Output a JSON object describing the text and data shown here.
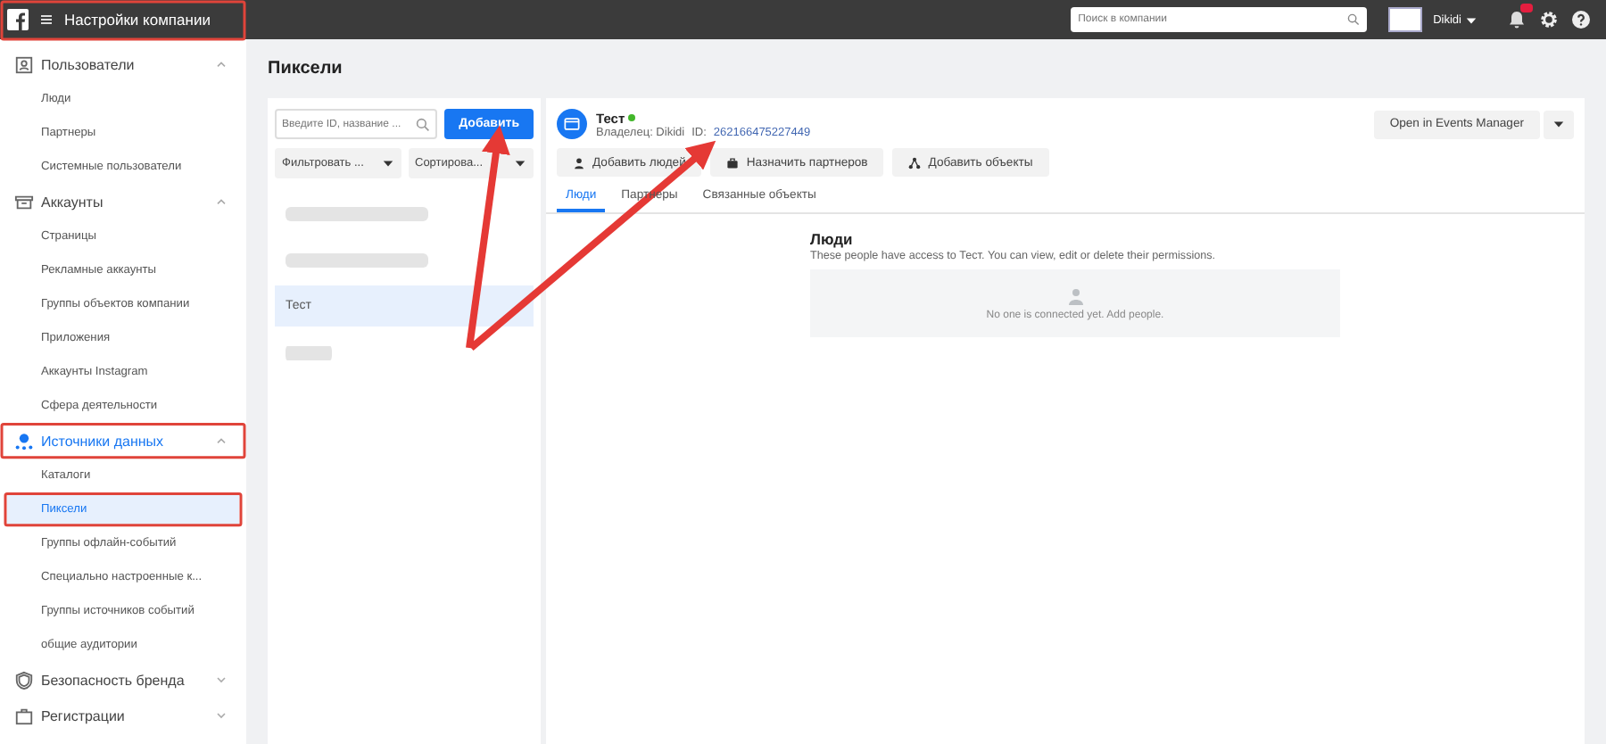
{
  "topbar": {
    "title": "Настройки компании",
    "search": {
      "placeholder": "Поиск в компании"
    },
    "user": {
      "name": "Dikidi"
    },
    "notifications": {
      "unread": true
    }
  },
  "sidebar": {
    "sections": [
      {
        "label": "Пользователи",
        "expanded": true,
        "selected": false,
        "children": [
          {
            "label": "Люди",
            "selected": false
          },
          {
            "label": "Партнеры",
            "selected": false
          },
          {
            "label": "Системные пользователи",
            "selected": false
          }
        ]
      },
      {
        "label": "Аккаунты",
        "expanded": true,
        "selected": false,
        "children": [
          {
            "label": "Страницы",
            "selected": false
          },
          {
            "label": "Рекламные аккаунты",
            "selected": false
          },
          {
            "label": "Группы объектов компании",
            "selected": false
          },
          {
            "label": "Приложения",
            "selected": false
          },
          {
            "label": "Аккаунты Instagram",
            "selected": false
          },
          {
            "label": "Сфера деятельности",
            "selected": false
          }
        ]
      },
      {
        "label": "Источники данных",
        "expanded": true,
        "selected": true,
        "children": [
          {
            "label": "Каталоги",
            "selected": false
          },
          {
            "label": "Пиксели",
            "selected": true
          },
          {
            "label": "Группы офлайн-событий",
            "selected": false
          },
          {
            "label": "Специально настроенные к...",
            "selected": false
          },
          {
            "label": "Группы источников событий",
            "selected": false
          },
          {
            "label": "общие аудитории",
            "selected": false
          }
        ]
      },
      {
        "label": "Безопасность бренда",
        "expanded": false,
        "selected": false
      },
      {
        "label": "Регистрации",
        "expanded": false,
        "selected": false
      }
    ]
  },
  "page_title": "Пиксели",
  "pixel_list": {
    "search": {
      "placeholder": "Введите ID, название ..."
    },
    "add_button": "Добавить",
    "filter": "Фильтровать ...",
    "sort": "Сортирова...",
    "items": [
      {
        "kind": "blurred",
        "selected": false
      },
      {
        "kind": "blurred",
        "selected": false
      },
      {
        "kind": "text",
        "label": "Тест",
        "selected": true
      },
      {
        "kind": "blurred",
        "selected": false
      }
    ]
  },
  "detail": {
    "name": "Тест",
    "active": true,
    "owner": "Владелец: Dikidi",
    "id_label": "ID:",
    "id": "262166475227449",
    "open_button": "Open in Events Manager",
    "actions": [
      "Добавить людей",
      "Назначить партнеров",
      "Добавить объекты"
    ],
    "tabs": [
      {
        "label": "Люди",
        "selected": true
      },
      {
        "label": "Партнеры",
        "selected": false
      },
      {
        "label": "Связанные объекты",
        "selected": false
      }
    ],
    "people": {
      "heading": "Люди",
      "description": "These people have access to Тест. You can view, edit or delete their permissions.",
      "empty": "No one is connected yet. Add people."
    }
  }
}
